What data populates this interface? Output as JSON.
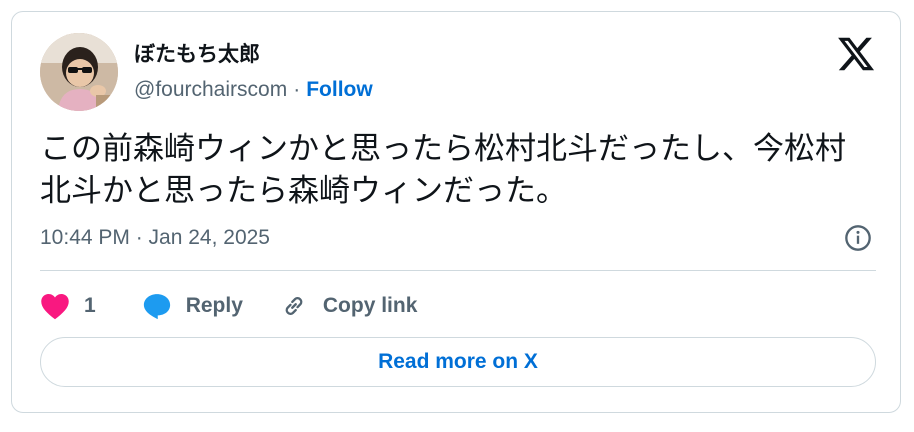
{
  "author": {
    "display_name": "ぼたもち太郎",
    "handle": "@fourchairscom",
    "separator": "·",
    "follow_label": "Follow",
    "avatar_icon": "child-avatar-photo"
  },
  "tweet": {
    "text": "この前森崎ウィンかと思ったら松村北斗だったし、今松村北斗かと思ったら森崎ウィンだった。",
    "timestamp": "10:44 PM · Jan 24, 2025"
  },
  "actions": {
    "like_count": "1",
    "reply_label": "Reply",
    "copy_link_label": "Copy link"
  },
  "footer": {
    "read_more_label": "Read more on X"
  },
  "icons": {
    "brand": "x-logo-icon",
    "info": "info-icon",
    "like": "heart-icon",
    "reply": "speech-bubble-icon",
    "copy": "link-icon"
  },
  "colors": {
    "like": "#f91880",
    "reply": "#1d9bf0",
    "link_blue": "#006fd6",
    "text": "#0f1419",
    "secondary": "#536471",
    "border": "#cfd9de"
  }
}
